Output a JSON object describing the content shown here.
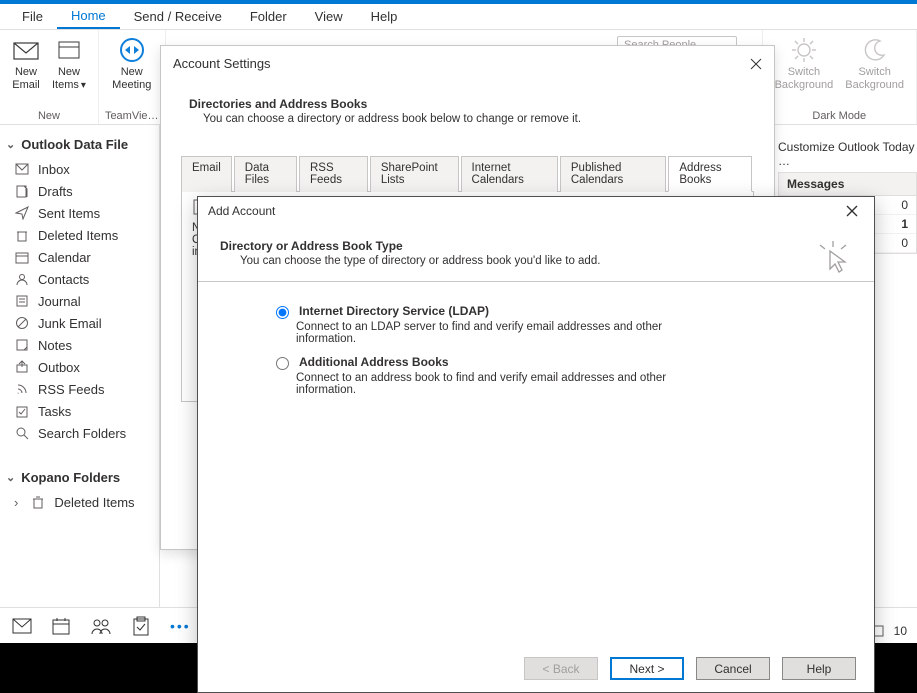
{
  "menubar": [
    "File",
    "Home",
    "Send / Receive",
    "Folder",
    "View",
    "Help"
  ],
  "menubar_active_index": 1,
  "ribbon": {
    "group_new_label": "New",
    "group_teamviewer_label": "TeamVie…",
    "group_darkmode_label": "Dark Mode",
    "new_email": "New\nEmail",
    "new_items": "New\nItems",
    "new_meeting": "New\nMeeting",
    "switch_bg1": "Switch\nBackground",
    "switch_bg2": "Switch\nBackground",
    "search_placeholder": "Search People"
  },
  "sidebar": {
    "group1_title": "Outlook Data File",
    "items1": [
      "Inbox",
      "Drafts",
      "Sent Items",
      "Deleted Items",
      "Calendar",
      "Contacts",
      "Journal",
      "Junk Email",
      "Notes",
      "Outbox",
      "RSS Feeds",
      "Tasks",
      "Search Folders"
    ],
    "group2_title": "Kopano Folders",
    "items2_label": "Deleted Items"
  },
  "right": {
    "customize": "Customize Outlook Today …",
    "messages_header": "Messages",
    "rows": [
      "0",
      "1",
      "0"
    ],
    "status_count": "10"
  },
  "dialog1": {
    "title": "Account Settings",
    "heading": "Directories and Address Books",
    "subtext": "You can choose a directory or address book below to change or remove it.",
    "tabs": [
      "Email",
      "Data Files",
      "RSS Feeds",
      "SharePoint Lists",
      "Internet Calendars",
      "Published Calendars",
      "Address Books"
    ],
    "active_tab_index": 6,
    "col_name_initial": "Na",
    "col_other_initial": "O",
    "col_in_initial": "in"
  },
  "dialog2": {
    "title": "Add Account",
    "heading": "Directory or Address Book Type",
    "subheading": "You can choose the type of directory or address book you'd like to add.",
    "opt1_label": "Internet Directory Service (LDAP)",
    "opt1_desc": "Connect to an LDAP server to find and verify email addresses and other information.",
    "opt2_label": "Additional Address Books",
    "opt2_desc": "Connect to an address book to find and verify email addresses and other information.",
    "buttons": {
      "back": "< Back",
      "next": "Next >",
      "cancel": "Cancel",
      "help": "Help"
    }
  }
}
